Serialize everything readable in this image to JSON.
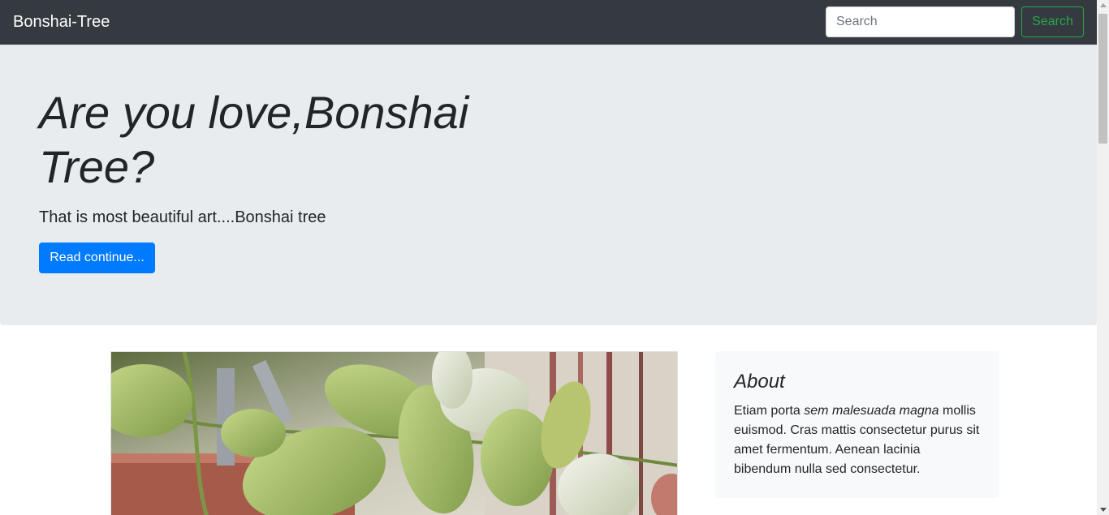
{
  "navbar": {
    "brand": "Bonshai-Tree",
    "search_placeholder": "Search",
    "search_button": "Search"
  },
  "jumbotron": {
    "title": "Are you love,Bonshai Tree?",
    "lead": "That is most beautiful art....Bonshai tree",
    "button": "Read continue..."
  },
  "about": {
    "title": "About",
    "text_before": "Etiam porta ",
    "text_emphasis": "sem malesuada magna",
    "text_after": " mollis euismod. Cras mattis consectetur purus sit amet fermentum. Aenean lacinia bibendum nulla sed consectetur."
  },
  "colors": {
    "navbar_bg": "#343a40",
    "jumbotron_bg": "#e9ecef",
    "primary": "#007bff",
    "success": "#28a745"
  },
  "icons": {
    "photo": "bonsai-leaves-photo"
  }
}
